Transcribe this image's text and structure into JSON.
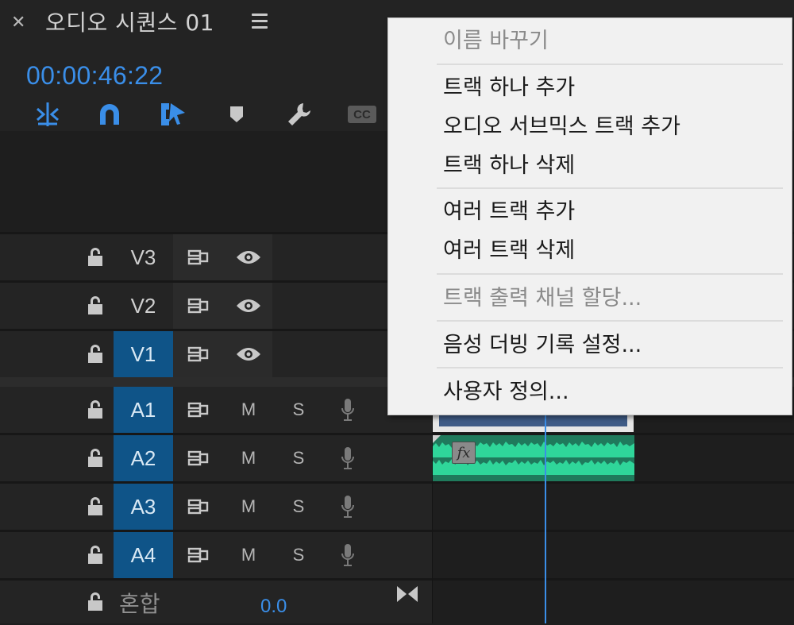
{
  "sequence": {
    "title": "오디오 시퀀스 01",
    "timecode": "00:00:46:22"
  },
  "toolbar": {
    "icons": [
      "ripple-snap-icon",
      "magnet-snap-icon",
      "linked-selection-icon",
      "add-marker-icon",
      "wrench-settings-icon",
      "captions-icon"
    ],
    "captions_label": "CC"
  },
  "tracks": [
    {
      "id": "V3",
      "type": "video",
      "targeted": false
    },
    {
      "id": "V2",
      "type": "video",
      "targeted": false
    },
    {
      "id": "V1",
      "type": "video",
      "targeted": true
    },
    {
      "id": "A1",
      "type": "audio",
      "targeted": true
    },
    {
      "id": "A2",
      "type": "audio",
      "targeted": true
    },
    {
      "id": "A3",
      "type": "audio",
      "targeted": true
    },
    {
      "id": "A4",
      "type": "audio",
      "targeted": true
    }
  ],
  "audio_buttons": {
    "mute": "M",
    "solo": "S"
  },
  "mix": {
    "label": "혼합",
    "value": "0.0"
  },
  "clip": {
    "fx_label": "fx"
  },
  "context_menu": {
    "items": [
      {
        "label": "이름 바꾸기",
        "enabled": false
      },
      {
        "label": "트랙 하나 추가",
        "enabled": true
      },
      {
        "label": "오디오 서브믹스 트랙 추가",
        "enabled": true
      },
      {
        "label": "트랙 하나 삭제",
        "enabled": true
      },
      {
        "label": "여러 트랙 추가",
        "enabled": true
      },
      {
        "label": "여러 트랙 삭제",
        "enabled": true
      },
      {
        "label": "트랙 출력 채널 할당...",
        "enabled": false
      },
      {
        "label": "음성 더빙 기록 설정...",
        "enabled": true
      },
      {
        "label": "사용자 정의...",
        "enabled": true
      }
    ]
  },
  "colors": {
    "accent": "#3a8ee8",
    "targeted_track": "#0f5488",
    "audio_clip": "#1f7a5c",
    "waveform": "#2fd69a",
    "video_clip": "#3f5b86",
    "menu_bg": "#f1f1f1"
  }
}
